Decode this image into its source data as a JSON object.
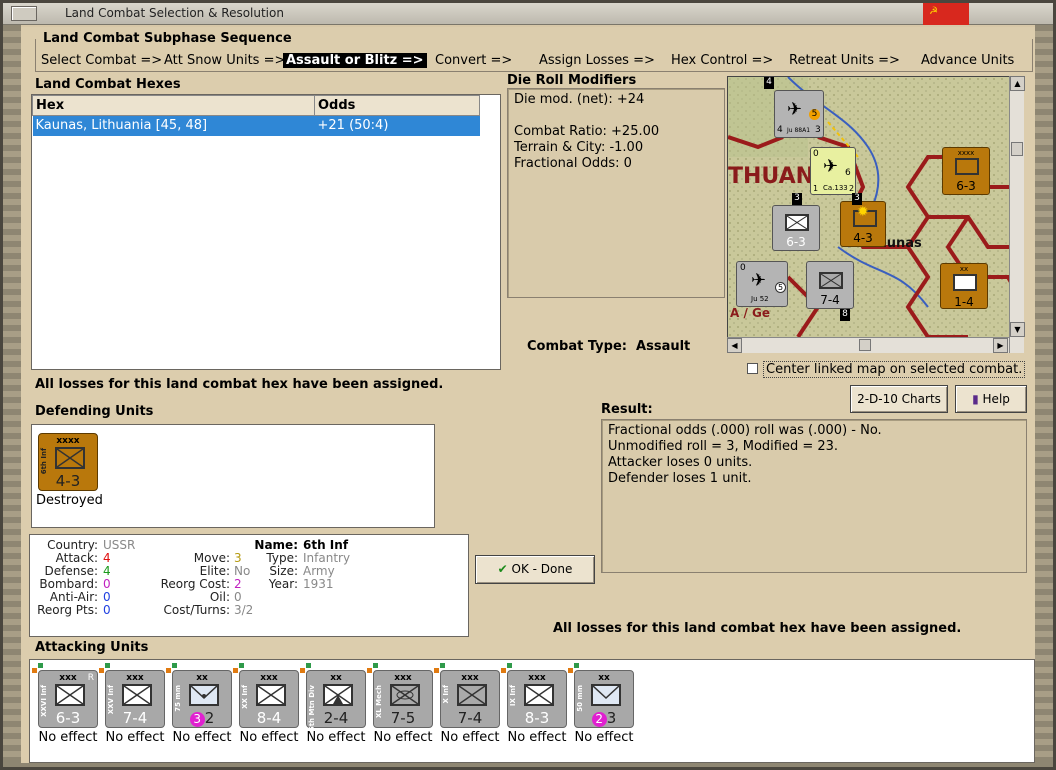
{
  "window": {
    "title": "Land Combat Selection & Resolution"
  },
  "colors": {
    "selection": "#2f87d6",
    "frame_tan": "#dccdad",
    "soviet_brown": "#b9780c",
    "german_grey": "#a8a8a8"
  },
  "subphase": {
    "heading": "Land Combat Subphase Sequence",
    "steps": [
      "Select Combat =>",
      "Att Snow Units =>",
      "Assault or Blitz =>",
      "Convert =>",
      "Assign Losses =>",
      "Hex Control =>",
      "Retreat Units =>",
      "Advance Units"
    ],
    "active_index": 2
  },
  "hexes": {
    "heading": "Land Combat Hexes",
    "columns": [
      "Hex",
      "Odds"
    ],
    "rows": [
      {
        "hex": "Kaunas, Lithuania [45, 48]",
        "odds": "+21 (50:4)"
      }
    ]
  },
  "modifiers": {
    "heading": "Die Roll Modifiers",
    "lines": [
      "Die mod. (net): +24",
      "",
      "Combat Ratio: +25.00",
      "Terrain & City: -1.00",
      "Fractional Odds: 0"
    ]
  },
  "combat_type": {
    "label": "Combat Type:",
    "value": "Assault"
  },
  "center_map": {
    "label": "Center linked map on selected combat.",
    "checked": false
  },
  "losses_msg": "All losses for this land combat hex have been assigned.",
  "defending": {
    "heading": "Defending Units",
    "units": [
      {
        "size": "xxxx",
        "name": "6th Inf",
        "strength": "4-3",
        "status": "Destroyed"
      }
    ]
  },
  "details": {
    "country_label": "Country:",
    "country": "USSR",
    "attack_label": "Attack:",
    "attack": "4",
    "defense_label": "Defense:",
    "defense": "4",
    "bombard_label": "Bombard:",
    "bombard": "0",
    "antiair_label": "Anti-Air:",
    "antiair": "0",
    "reorgpts_label": "Reorg Pts:",
    "reorgpts": "0",
    "move_label": "Move:",
    "move": "3",
    "elite_label": "Elite:",
    "elite": "No",
    "reorgcost_label": "Reorg Cost:",
    "reorgcost": "2",
    "oil_label": "Oil:",
    "oil": "0",
    "costturns_label": "Cost/Turns:",
    "costturns": "3/2",
    "name_label": "Name:",
    "name": "6th Inf",
    "type_label": "Type:",
    "type": "Infantry",
    "size_label": "Size:",
    "size": "Army",
    "year_label": "Year:",
    "year": "1931"
  },
  "buttons": {
    "charts": "2-D-10 Charts",
    "help": "Help",
    "ok": "OK - Done"
  },
  "result": {
    "heading": "Result:",
    "lines": [
      "Fractional odds (.000) roll was (.000)  - No.",
      "Unmodified roll = 3, Modified = 23.",
      "Attacker loses 0 units.",
      "Defender loses 1 unit."
    ]
  },
  "attacking": {
    "heading": "Attacking Units",
    "units": [
      {
        "size": "xxx",
        "name": "XXVI Inf",
        "strength": "6-3",
        "effect": "No effect",
        "tag": "R"
      },
      {
        "size": "xxx",
        "name": "XXV Inf",
        "strength": "7-4",
        "effect": "No effect",
        "tag": ""
      },
      {
        "size": "xx",
        "name": "75 mm",
        "strength": "2",
        "badge": "3",
        "effect": "No effect",
        "tag": ""
      },
      {
        "size": "xxx",
        "name": "XX Inf",
        "strength": "8-4",
        "effect": "No effect",
        "tag": ""
      },
      {
        "size": "xx",
        "name": "5th Mtn Div",
        "strength": "2-4",
        "effect": "No effect",
        "tag": ""
      },
      {
        "size": "xxx",
        "name": "XL Mech",
        "strength": "7-5",
        "effect": "No effect",
        "tag": ""
      },
      {
        "size": "xxx",
        "name": "X Inf",
        "strength": "7-4",
        "effect": "No effect",
        "tag": ""
      },
      {
        "size": "xxx",
        "name": "IX Inf",
        "strength": "8-3",
        "effect": "No effect",
        "tag": ""
      },
      {
        "size": "xx",
        "name": "50 mm",
        "strength": "3",
        "badge": "2",
        "effect": "No effect",
        "tag": ""
      }
    ]
  },
  "map": {
    "labels": [
      "THUAN",
      "aunas",
      "A / Ge"
    ],
    "counters": [
      {
        "name": "Ju 88A1",
        "strength": "4",
        "extra": "3",
        "badge": "5"
      },
      {
        "name": "Ca.133",
        "strength": "1",
        "extra": "2",
        "top": "0",
        "right": "6"
      },
      {
        "name": "XXVI Inf",
        "strength": "6-3"
      },
      {
        "name": "6th Inf",
        "strength": "4-3"
      },
      {
        "name": "Ju 52",
        "top": "0",
        "badge": "5"
      },
      {
        "name": "X Inf",
        "strength": "7-4"
      },
      {
        "name": "5th Inf",
        "strength": "6-3",
        "size": "xxxx"
      },
      {
        "name": "Cav",
        "strength": "1-4",
        "size": "xx"
      }
    ],
    "stack_numbers": [
      "4",
      "3",
      "3",
      "8"
    ]
  }
}
